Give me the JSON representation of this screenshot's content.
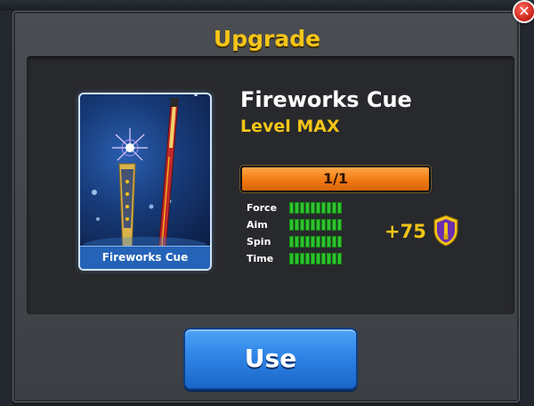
{
  "dialog": {
    "title": "Upgrade",
    "close_icon": "close-icon"
  },
  "card": {
    "label": "Fireworks Cue",
    "image_icon": "fireworks-cue-image"
  },
  "cue": {
    "name": "Fireworks Cue",
    "level": "Level MAX",
    "progress_text": "1/1",
    "progress_fraction": 1.0
  },
  "stats": [
    {
      "label": "Force",
      "filled": 10,
      "total": 10
    },
    {
      "label": "Aim",
      "filled": 10,
      "total": 10
    },
    {
      "label": "Spin",
      "filled": 10,
      "total": 10
    },
    {
      "label": "Time",
      "filled": 10,
      "total": 10
    }
  ],
  "bonus": {
    "text": "+75",
    "icon": "cue-shield-icon"
  },
  "actions": {
    "use_label": "Use"
  },
  "colors": {
    "title": "#f5c518",
    "progress": "#f27a12",
    "stat_bar": "#2ec22e",
    "use_button": "#2f84e6",
    "close_button": "#c81e16"
  }
}
